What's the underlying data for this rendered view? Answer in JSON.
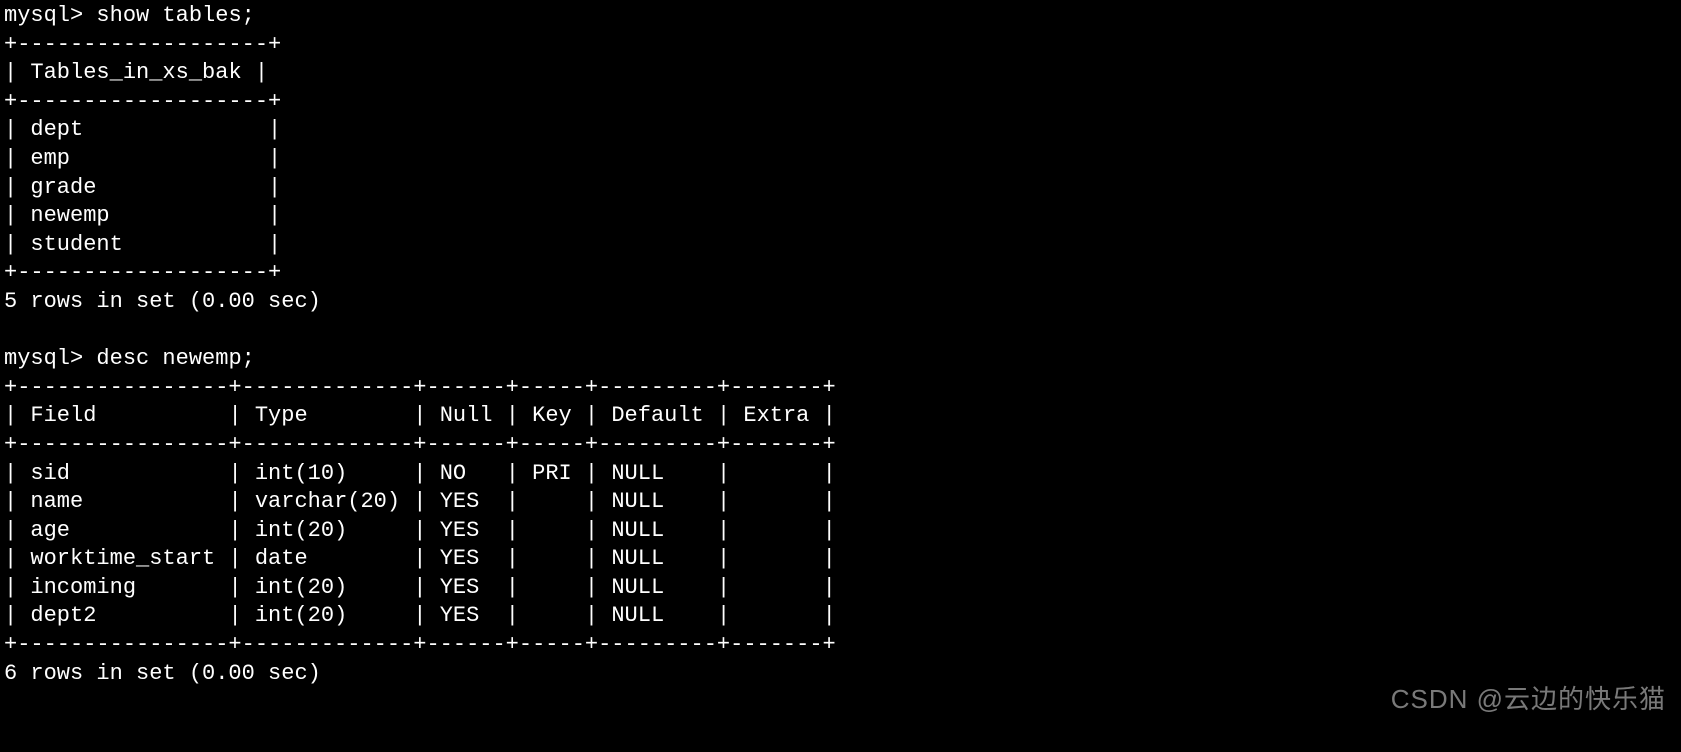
{
  "prompt": "mysql>",
  "query1": {
    "command": "show tables;",
    "header": "Tables_in_xs_bak",
    "rows": [
      "dept",
      "emp",
      "grade",
      "newemp",
      "student"
    ],
    "status": "5 rows in set (0.00 sec)"
  },
  "query2": {
    "command": "desc newemp;",
    "headers": [
      "Field",
      "Type",
      "Null",
      "Key",
      "Default",
      "Extra"
    ],
    "rows": [
      {
        "field": "sid",
        "type": "int(10)",
        "null": "NO",
        "key": "PRI",
        "default": "NULL",
        "extra": ""
      },
      {
        "field": "name",
        "type": "varchar(20)",
        "null": "YES",
        "key": "",
        "default": "NULL",
        "extra": ""
      },
      {
        "field": "age",
        "type": "int(20)",
        "null": "YES",
        "key": "",
        "default": "NULL",
        "extra": ""
      },
      {
        "field": "worktime_start",
        "type": "date",
        "null": "YES",
        "key": "",
        "default": "NULL",
        "extra": ""
      },
      {
        "field": "incoming",
        "type": "int(20)",
        "null": "YES",
        "key": "",
        "default": "NULL",
        "extra": ""
      },
      {
        "field": "dept2",
        "type": "int(20)",
        "null": "YES",
        "key": "",
        "default": "NULL",
        "extra": ""
      }
    ],
    "status": "6 rows in set (0.00 sec)"
  },
  "watermark": "CSDN @云边的快乐猫"
}
